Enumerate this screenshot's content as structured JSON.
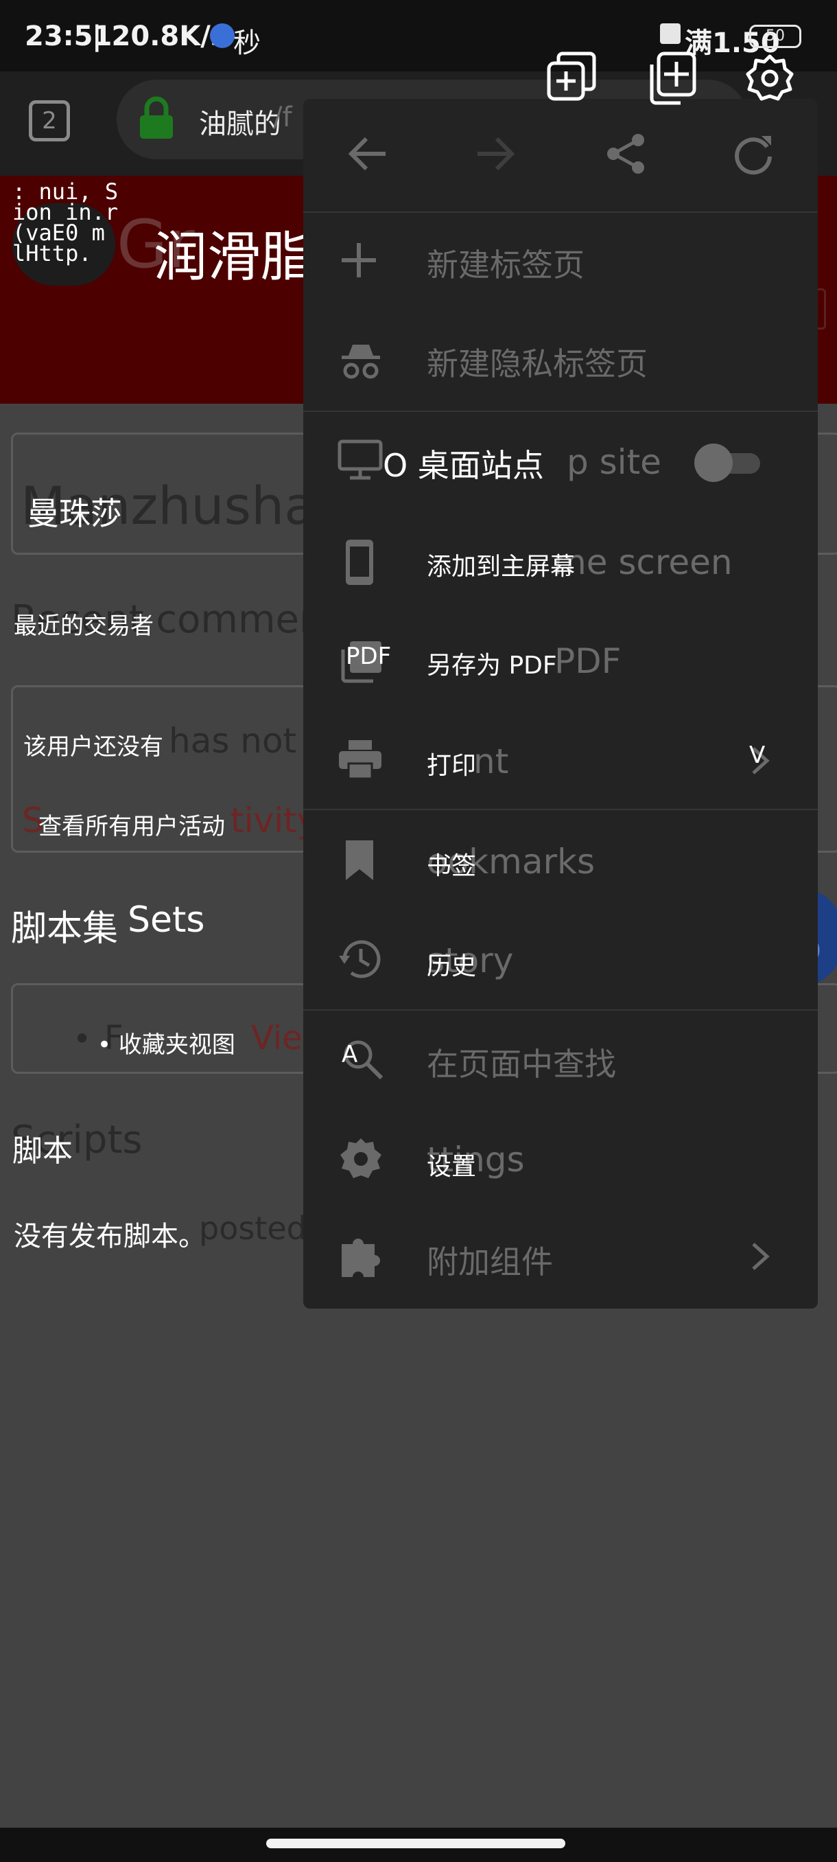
{
  "status_bar": {
    "time": "23:51",
    "speed_overlay": "| 20.8K/s",
    "speed_unit": "秒",
    "right_overlay": "满1.50",
    "battery": "50"
  },
  "toolbar": {
    "tab_count": "2",
    "url_overlay": "油腻的",
    "url_ghost": "/f"
  },
  "header": {
    "logo_lines": [
      ": nui, S",
      "ion in.r",
      " (vaE0 m",
      "lHttp."
    ],
    "site_ghost": "Gr",
    "site_title": "润滑脂+"
  },
  "profile": {
    "name_ghost": "Manzhushal",
    "name_overlay": "曼珠莎"
  },
  "recent": {
    "heading_ghost": "Recent comment",
    "heading_overlay": "最近的交易者",
    "text_ghost": "has not p",
    "text_overlay": "该用户还没有",
    "link_ghost": "S",
    "link_ghost_tail": "tivity",
    "link_overlay": "查看所有用户活动"
  },
  "script_sets": {
    "heading_overlay": "脚本集",
    "heading_ghost": "Sets",
    "bullet": "•",
    "item_ghost_prefix": "F",
    "item_overlay": "• 收藏夹视图",
    "item_link_ghost": "Vie"
  },
  "scripts": {
    "heading_ghost": "Scripts",
    "heading_overlay": "脚本",
    "text_ghost": "posted.",
    "text_overlay": "没有发布脚本。"
  },
  "top_actions": {
    "icons": [
      "duplicate-tab-icon",
      "new-tab-icon",
      "settings-gear-icon"
    ]
  },
  "menu": {
    "nav_icons": [
      "back-arrow-icon",
      "forward-arrow-icon",
      "share-icon",
      "reload-icon"
    ],
    "items": [
      {
        "ghost": "新建标签页",
        "overlay": ""
      },
      {
        "ghost": "新建隐私标签页",
        "overlay": ""
      },
      {
        "ghost": "p site",
        "overlay": "O 桌面站点",
        "toggle": false
      },
      {
        "ghost": "me screen",
        "overlay": "添加到主屏幕"
      },
      {
        "ghost": "PDF",
        "overlay": "另存为 PDF",
        "icon_overlay": "PDF"
      },
      {
        "ghost": "nt",
        "overlay": "打印",
        "chevron_overlay": "V"
      },
      {
        "ghost": "ookmarks",
        "overlay": "书签"
      },
      {
        "ghost": "story",
        "overlay": "历史"
      },
      {
        "ghost": "在页面中查找",
        "overlay": "",
        "icon_overlay": "A"
      },
      {
        "ghost": "ttings",
        "overlay": "设置"
      },
      {
        "ghost": "附加组件",
        "overlay": ""
      }
    ]
  },
  "colors": {
    "header_red": "#4c0000",
    "menu_bg": "#232323",
    "translate_fab": "#1c3f86",
    "link_red": "#6e2424"
  }
}
